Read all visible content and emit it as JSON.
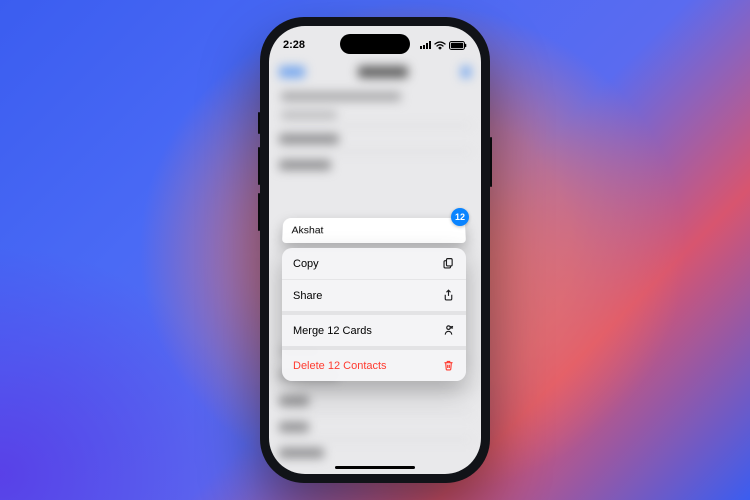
{
  "status": {
    "time": "2:28"
  },
  "selection": {
    "contact_name": "Akshat",
    "badge_count": "12"
  },
  "menu": {
    "copy": {
      "label": "Copy"
    },
    "share": {
      "label": "Share"
    },
    "merge": {
      "label": "Merge 12 Cards"
    },
    "delete": {
      "label": "Delete 12 Contacts"
    }
  }
}
